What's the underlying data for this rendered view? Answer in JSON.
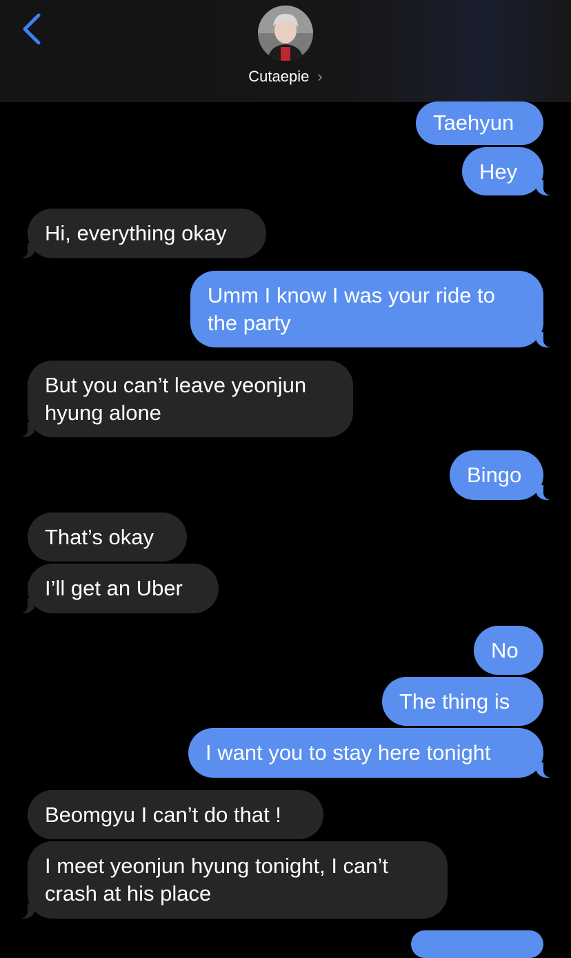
{
  "header": {
    "contact_name": "Cutaepie",
    "chevron": "›",
    "back_icon": "chevron-left-icon",
    "accent": "#3b82f6"
  },
  "messages": [
    {
      "dir": "out",
      "text": "Taehyun"
    },
    {
      "dir": "out",
      "text": "Hey"
    },
    {
      "dir": "in",
      "text": "Hi, everything okay"
    },
    {
      "dir": "out",
      "text": "Umm I know I was your ride to the party"
    },
    {
      "dir": "in",
      "text": "But you can’t leave yeonjun hyung alone"
    },
    {
      "dir": "out",
      "text": "Bingo"
    },
    {
      "dir": "in",
      "text": "That’s okay"
    },
    {
      "dir": "in",
      "text": "I’ll get an Uber"
    },
    {
      "dir": "out",
      "text": "No"
    },
    {
      "dir": "out",
      "text": "The thing is"
    },
    {
      "dir": "out",
      "text": "I want you to stay here tonight"
    },
    {
      "dir": "in",
      "text": "Beomgyu I can’t do that !"
    },
    {
      "dir": "in",
      "text": "I meet yeonjun hyung tonight, I can’t crash at his place"
    }
  ],
  "colors": {
    "outgoing_bubble": "#5a8ff0",
    "incoming_bubble": "#262628",
    "background": "#000000"
  }
}
